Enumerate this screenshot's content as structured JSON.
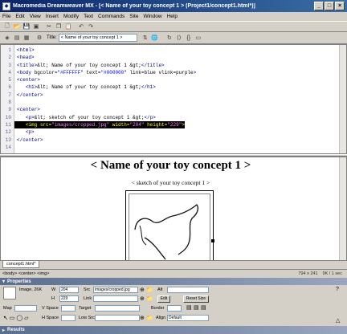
{
  "window": {
    "title": "Macromedia Dreamweaver MX - [< Name of your toy concept 1 > (Project1/concept1.html*)]"
  },
  "menu": [
    "File",
    "Edit",
    "View",
    "Insert",
    "Modify",
    "Text",
    "Commands",
    "Site",
    "Window",
    "Help"
  ],
  "toolbar": {
    "title_label": "Title:",
    "title_value": "< Name of your toy concept 1 >"
  },
  "code_lines": [
    {
      "n": "1",
      "html": "<span class='tag'>&lt;html&gt;</span>"
    },
    {
      "n": "2",
      "html": "<span class='tag'>&lt;head&gt;</span>"
    },
    {
      "n": "3",
      "html": "<span class='tag'>&lt;title&gt;</span><span class='txt'>&amp;lt; Name of your toy concept 1 &amp;gt;</span><span class='tag'>&lt;/title&gt;</span>"
    },
    {
      "n": "4",
      "html": "<span class='tag'>&lt;body </span><span class='attr'>bgcolor=</span><span class='val'>\"#FFFFFF\"</span><span class='attr'> text=</span><span class='val'>\"#000000\"</span><span class='attr'> link=blue vlink=purple</span><span class='tag'>&gt;</span>"
    },
    {
      "n": "5",
      "html": "<span class='tag'>&lt;center&gt;</span>"
    },
    {
      "n": "6",
      "html": "   <span class='tag'>&lt;h1&gt;</span><span class='txt'>&amp;lt; Name of your toy concept 1 &amp;gt;</span><span class='tag'>&lt;/h1&gt;</span>"
    },
    {
      "n": "7",
      "html": "<span class='tag'>&lt;/center&gt;</span>"
    },
    {
      "n": "8",
      "html": ""
    },
    {
      "n": "9",
      "html": "<span class='tag'>&lt;center&gt;</span>"
    },
    {
      "n": "10",
      "html": "   <span class='tag'>&lt;p&gt;</span><span class='txt'>&amp;lt; sketch of your toy concept 1 &amp;gt;</span><span class='tag'>&lt;/p&gt;</span>"
    },
    {
      "n": "11",
      "html": "   <span class='tag'>&lt;img </span><span class='attr'>src=</span><span class='val'>\"images/cropped.jpg\"</span><span class='attr'> width=</span><span class='val'>\"204\"</span><span class='attr'> height=</span><span class='val'>\"229\"</span><span class='tag'>&gt;</span>",
      "hl": true
    },
    {
      "n": "12",
      "html": "   <span class='tag'>&lt;p&gt;</span>"
    },
    {
      "n": "13",
      "html": "<span class='tag'>&lt;/center&gt;</span>"
    },
    {
      "n": "14",
      "html": ""
    }
  ],
  "design": {
    "heading": "< Name of your toy concept 1 >",
    "caption": "< sketch of your toy concept 1 >"
  },
  "doc_tab": "concept1.html*",
  "status": {
    "path": "<body> <center> <img>",
    "size": "794 x 241",
    "download": "9K / 1 sec"
  },
  "properties": {
    "header": "Properties",
    "image_label": "Image, 26K",
    "w_label": "W",
    "w_value": "204",
    "h_label": "H",
    "h_value": "229",
    "src_label": "Src",
    "src_value": "images/cropped.jpg",
    "link_label": "Link",
    "link_value": "",
    "alt_label": "Alt",
    "alt_value": "",
    "edit_label": "Edit",
    "reset_label": "Reset Size",
    "map_label": "Map",
    "vspace_label": "V Space",
    "hspace_label": "H Space",
    "target_label": "Target",
    "lowsrc_label": "Low Src",
    "border_label": "Border",
    "align_label": "Align",
    "align_value": "Default"
  },
  "results": {
    "header": "Results"
  }
}
